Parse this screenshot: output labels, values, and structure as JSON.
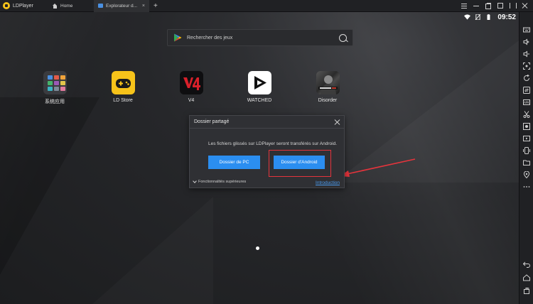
{
  "titlebar": {
    "app_name": "LDPlayer",
    "tabs": [
      {
        "label": "Home",
        "icon": "home-icon",
        "active": false
      },
      {
        "label": "Explorateur d...",
        "icon": "folder-icon",
        "active": true
      }
    ],
    "add_tab": "+",
    "controls": [
      "menu-icon",
      "minimize-icon",
      "restore-icon",
      "maximize-icon",
      "wrap-icon",
      "close-icon"
    ]
  },
  "status_bar": {
    "clock": "09:52",
    "icons": [
      "wifi-icon",
      "no-sim-icon",
      "battery-icon"
    ]
  },
  "search": {
    "placeholder": "Rechercher des jeux"
  },
  "apps": [
    {
      "label": "系统应用",
      "icon": "system-apps-icon"
    },
    {
      "label": "LD Store",
      "icon": "ld-store-icon"
    },
    {
      "label": "V4",
      "icon": "v4-icon"
    },
    {
      "label": "WATCHED",
      "icon": "watched-icon"
    },
    {
      "label": "Disorder",
      "icon": "disorder-icon"
    }
  ],
  "dialog": {
    "title": "Dossier partagé",
    "message": "Les fichiers glissés sur LDPlayer seront transférés sur Android.",
    "btn_pc": "Dossier de PC",
    "btn_android": "Dossier d'Android",
    "advanced": "Fonctionnalités supérieures",
    "intro": "Introduction"
  },
  "colors": {
    "accent": "#2b8ef0",
    "highlight": "#e5343c",
    "link": "#4a9cf0",
    "logo": "#f7c31a"
  },
  "sidebar": {
    "icons": [
      "keyboard-icon",
      "volume-up-icon",
      "volume-down-icon",
      "screenshot-icon",
      "rotate-icon",
      "sync-icon",
      "apk-icon",
      "scissors-icon",
      "record-icon",
      "video-icon",
      "shake-icon",
      "folder-icon",
      "location-icon",
      "more-icon",
      "back-icon",
      "home-icon",
      "recent-apps-icon"
    ]
  }
}
